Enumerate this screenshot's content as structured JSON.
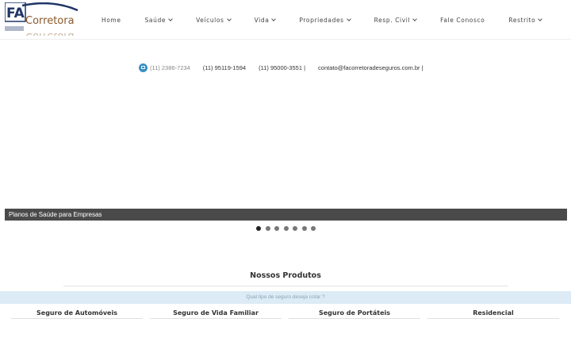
{
  "logo": {
    "letters": "FA",
    "wordmark": "Corretora"
  },
  "nav": {
    "items": [
      {
        "label": "Home",
        "has_dropdown": false
      },
      {
        "label": "Saúde",
        "has_dropdown": true
      },
      {
        "label": "Veículos",
        "has_dropdown": true
      },
      {
        "label": "Vida",
        "has_dropdown": true
      },
      {
        "label": "Propriedades",
        "has_dropdown": true
      },
      {
        "label": "Resp. Civil",
        "has_dropdown": true
      },
      {
        "label": "Fale Conosco",
        "has_dropdown": false
      },
      {
        "label": "Restrito",
        "has_dropdown": true
      }
    ]
  },
  "contact": {
    "phone1": "(11) 2386-7234",
    "phone2": "(11) 95119-1594",
    "phone3": "(11) 95000-3551 |",
    "email": "contato@facorretoradeseguros.com.br |"
  },
  "slider": {
    "caption": "Planos de Saúde para Empresas",
    "dot_count": 7,
    "active_dot": 1
  },
  "products": {
    "title": "Nossos Produtos",
    "subtitle": "Qual tipo de seguro deseja cotar ?",
    "items": [
      "Seguro de Automóveis",
      "Seguro de Vida Familiar",
      "Seguro de Portáteis",
      "Residencial"
    ]
  },
  "colors": {
    "accent_blue": "#3a8fc4",
    "logo_navy": "#1f3566",
    "logo_brown": "#8a5a2b",
    "caption_bg": "#4a4a4a",
    "subtitle_bg": "#dcebf5"
  },
  "icons": {
    "phone": "phone-icon",
    "chevron": "chevron-down-icon"
  }
}
